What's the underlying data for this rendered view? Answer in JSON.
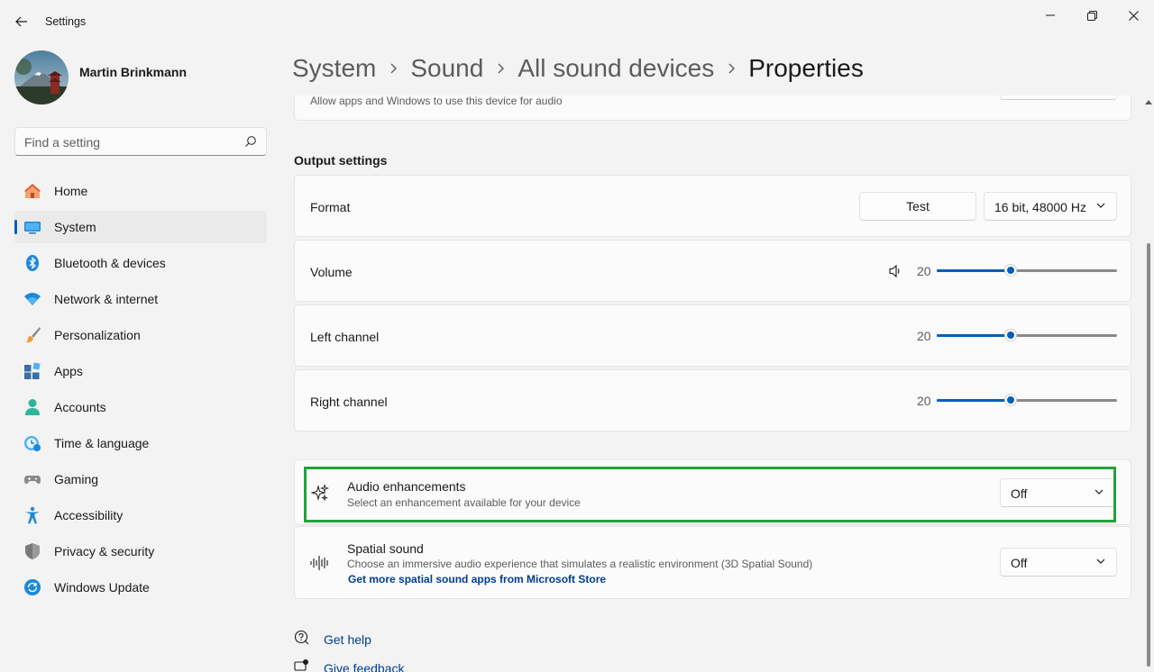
{
  "window": {
    "title": "Settings"
  },
  "profile": {
    "name": "Martin Brinkmann"
  },
  "search": {
    "placeholder": "Find a setting"
  },
  "nav": {
    "items": [
      {
        "label": "Home",
        "icon": "home-icon"
      },
      {
        "label": "System",
        "icon": "system-icon",
        "active": true
      },
      {
        "label": "Bluetooth & devices",
        "icon": "bluetooth-icon"
      },
      {
        "label": "Network & internet",
        "icon": "wifi-icon"
      },
      {
        "label": "Personalization",
        "icon": "brush-icon"
      },
      {
        "label": "Apps",
        "icon": "apps-icon"
      },
      {
        "label": "Accounts",
        "icon": "accounts-icon"
      },
      {
        "label": "Time & language",
        "icon": "clock-globe-icon"
      },
      {
        "label": "Gaming",
        "icon": "gamepad-icon"
      },
      {
        "label": "Accessibility",
        "icon": "accessibility-icon"
      },
      {
        "label": "Privacy & security",
        "icon": "shield-icon"
      },
      {
        "label": "Windows Update",
        "icon": "update-icon"
      }
    ]
  },
  "breadcrumb": {
    "items": [
      "System",
      "Sound",
      "All sound devices",
      "Properties"
    ]
  },
  "allow_card": {
    "description": "Allow apps and Windows to use this device for audio"
  },
  "output": {
    "section_title": "Output settings",
    "format": {
      "label": "Format",
      "test_label": "Test",
      "value": "16 bit, 48000 Hz"
    },
    "volume": {
      "label": "Volume",
      "value": "20",
      "level": 0.2
    },
    "left_channel": {
      "label": "Left channel",
      "value": "20",
      "level": 0.2
    },
    "right_channel": {
      "label": "Right channel",
      "value": "20",
      "level": 0.2
    }
  },
  "enhancements": {
    "title": "Audio enhancements",
    "description": "Select an enhancement available for your device",
    "value": "Off"
  },
  "spatial": {
    "title": "Spatial sound",
    "description": "Choose an immersive audio experience that simulates a realistic environment (3D Spatial Sound)",
    "link": "Get more spatial sound apps from Microsoft Store",
    "value": "Off"
  },
  "help": {
    "get_help": "Get help",
    "give_feedback": "Give feedback"
  },
  "colors": {
    "accent": "#005fb8",
    "highlight": "#22a33a",
    "link": "#003e92"
  }
}
